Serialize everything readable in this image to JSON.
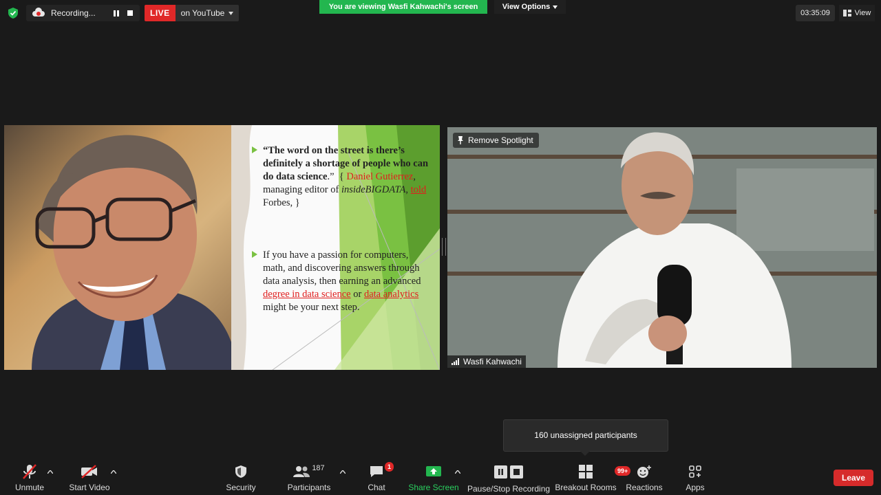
{
  "top_bar": {
    "recording_label": "Recording...",
    "live_label": "LIVE",
    "stream_target": "on YouTube",
    "viewing_banner": "You are viewing Wasfi Kahwachi's screen",
    "view_options_label": "View Options",
    "timer": "03:35:09",
    "view_label": "View"
  },
  "slide": {
    "bullet1": {
      "quote": "“The word on the street is there’s definitely a shortage of people who can do data science",
      "quote_end": ".”",
      "brace_open": "{",
      "name_link": "Daniel Gutierrez",
      "mid": ", managing editor of ",
      "publication": "insideBIGDATA",
      "comma": ", ",
      "told_link": "told",
      "end": " Forbes, }"
    },
    "bullet2": {
      "text1": "If you have a passion for computers, math, and discovering answers through data analysis, then earning an advanced ",
      "link1": "degree in data science",
      "or": " or ",
      "link2": "data analytics",
      "text2": " might be your next step."
    }
  },
  "speaker_tile": {
    "spotlight_label": "Remove Spotlight",
    "name": "Wasfi Kahwachi"
  },
  "popup": {
    "text": "160 unassigned participants"
  },
  "toolbar": {
    "unmute": "Unmute",
    "start_video": "Start Video",
    "security": "Security",
    "participants": "Participants",
    "participants_count": "187",
    "chat": "Chat",
    "chat_badge": "1",
    "share_screen": "Share Screen",
    "pause_stop_recording": "Pause/Stop Recording",
    "breakout_rooms": "Breakout Rooms",
    "breakout_badge": "99+",
    "reactions": "Reactions",
    "apps": "Apps",
    "leave": "Leave"
  },
  "colors": {
    "accent_green": "#23b64f",
    "live_red": "#e02828",
    "leave_red": "#d62b2b",
    "slide_green": "#7ac142"
  }
}
